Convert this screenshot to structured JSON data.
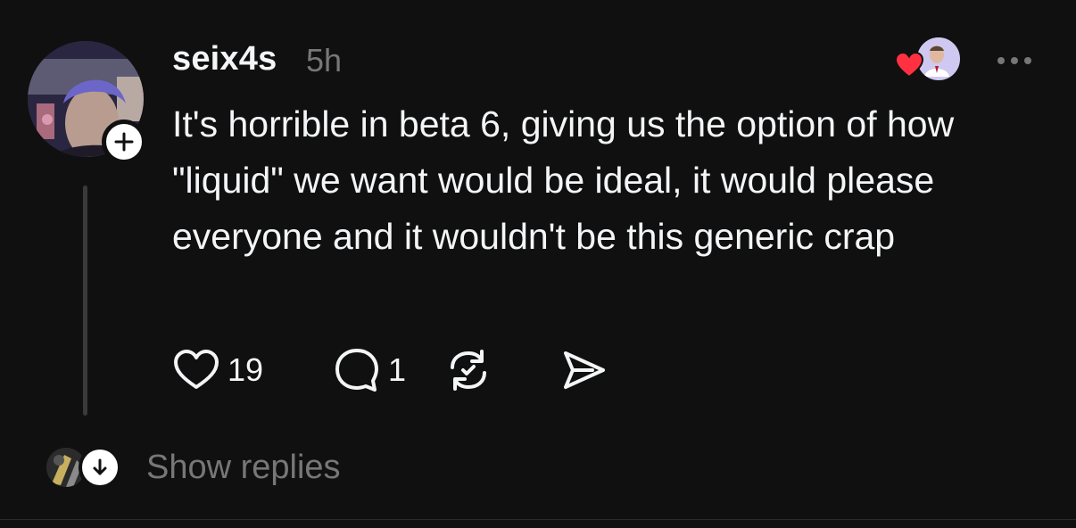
{
  "post": {
    "username": "seix4s",
    "timestamp": "5h",
    "text": "It's horrible in beta 6, giving us the option of how \"liquid\" we want would be ideal, it would please everyone and it wouldn't be this generic crap",
    "likes_count": "19",
    "replies_count": "1"
  },
  "icons": {
    "avatar": "user-avatar",
    "follow": "plus-icon",
    "like": "heart-icon",
    "reply": "comment-icon",
    "repost": "repost-icon",
    "share": "send-icon",
    "more": "more-dots-icon",
    "liked_by": "liker-avatar",
    "show_replies": "arrow-down-icon"
  },
  "replies": {
    "label": "Show replies"
  },
  "colors": {
    "background": "#101010",
    "text_primary": "#f3f5f7",
    "text_secondary": "#777777",
    "heart_red": "#ff3040",
    "thread_line": "#3a3a3a"
  }
}
